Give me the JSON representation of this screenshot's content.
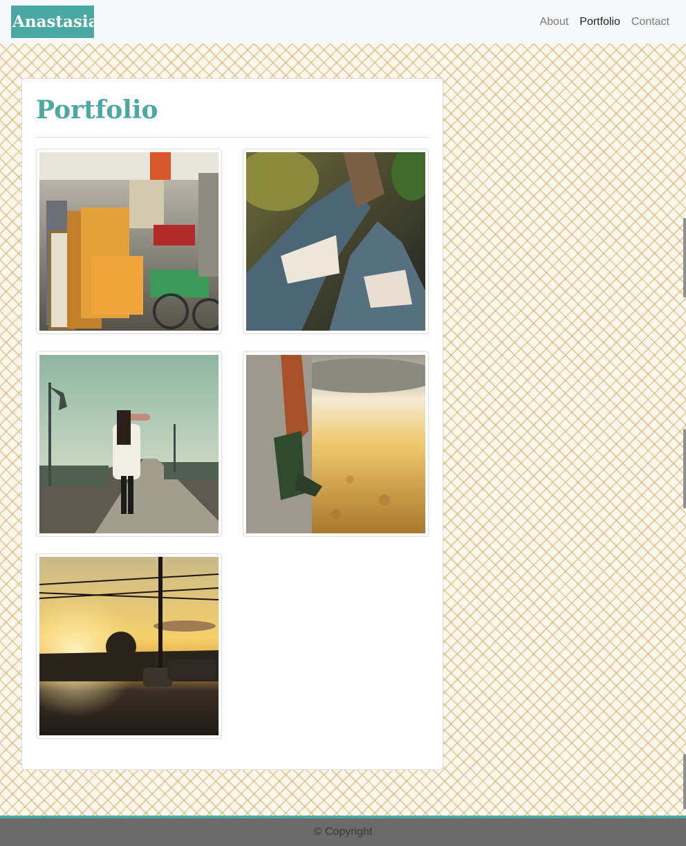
{
  "navbar": {
    "brand": "Anastasia I",
    "links": [
      "About",
      "Portfolio",
      "Contact"
    ],
    "active": "Portfolio"
  },
  "main": {
    "title": "Portfolio"
  },
  "footer": {
    "copyright": "© Copyright"
  },
  "colors": {
    "accent": "#4aa9a3",
    "footer": "#6b6b6b"
  }
}
